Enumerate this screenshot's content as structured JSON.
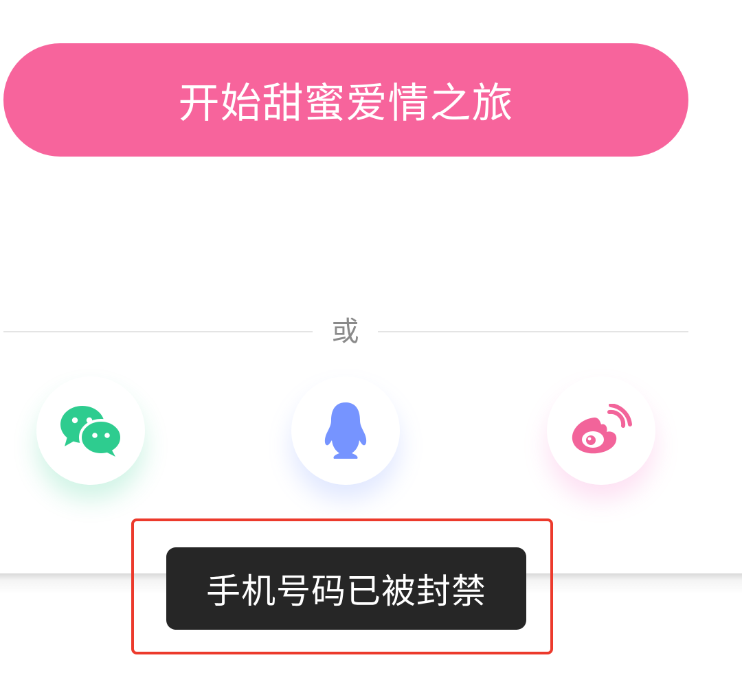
{
  "start_button": {
    "label": "开始甜蜜爱情之旅",
    "color": "#f7649c"
  },
  "divider": {
    "text": "或"
  },
  "social_login": [
    {
      "name": "wechat",
      "icon": "wechat-icon",
      "color": "#2ecc8f"
    },
    {
      "name": "qq",
      "icon": "qq-penguin-icon",
      "color": "#7694ff"
    },
    {
      "name": "weibo",
      "icon": "weibo-icon",
      "color": "#f2649a"
    }
  ],
  "toast": {
    "message": "手机号码已被封禁"
  },
  "annotation": {
    "highlight_color": "#ec3a2c"
  }
}
